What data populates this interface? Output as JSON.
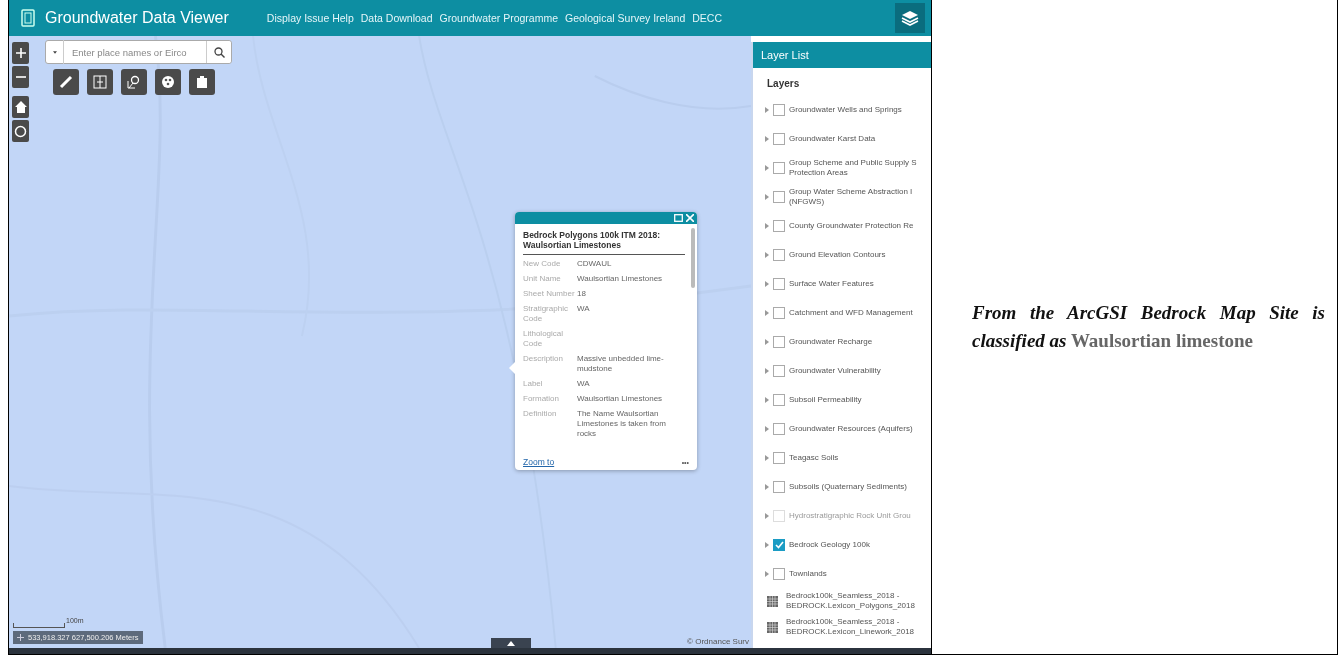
{
  "header": {
    "title": "Groundwater Data Viewer",
    "links": [
      "Display Issue Help",
      "Data Download",
      "Groundwater Programme",
      "Geological Survey Ireland",
      "DECC"
    ]
  },
  "search": {
    "placeholder": "Enter place names or Eirco"
  },
  "map": {
    "kind": "picture",
    "scale": "100m",
    "coordinates": "533,918.327 627,500.206 Meters",
    "attribution": "© Ordnance Surv"
  },
  "popup": {
    "title": "Bedrock Polygons 100k ITM 2018: Waulsortian Limestones",
    "fields": [
      {
        "label": "New Code",
        "value": "CDWAUL"
      },
      {
        "label": "Unit Name",
        "value": "Waulsortian Limestones"
      },
      {
        "label": "Sheet Number",
        "value": "18"
      },
      {
        "label": "Stratigraphic Code",
        "value": "WA"
      },
      {
        "label": "Lithological Code"
      },
      {
        "label": "Description",
        "value": "Massive unbedded lime-mudstone"
      },
      {
        "label": "Label",
        "value": "WA"
      },
      {
        "label": "Formation",
        "value": "Waulsortian Limestones"
      },
      {
        "label": "Definition",
        "value": "The Name Waulsortian Limestones is taken from rocks"
      }
    ],
    "link": "Zoom to",
    "more": "•••"
  },
  "layer_list": {
    "title": "Layer List",
    "heading": "Layers",
    "items": [
      {
        "kind": "layer",
        "label": "Groundwater Wells and Springs",
        "checked": false,
        "disabled": false
      },
      {
        "kind": "layer",
        "label": "Groundwater Karst Data",
        "checked": false,
        "disabled": false
      },
      {
        "kind": "layer",
        "label": "Group Scheme and Public Supply S Protection Areas",
        "checked": false,
        "disabled": false
      },
      {
        "kind": "layer",
        "label": "Group Water Scheme Abstraction I (NFGWS)",
        "checked": false,
        "disabled": false
      },
      {
        "kind": "layer",
        "label": "County Groundwater Protection Re",
        "checked": false,
        "disabled": false
      },
      {
        "kind": "layer",
        "label": "Ground Elevation Contours",
        "checked": false,
        "disabled": false
      },
      {
        "kind": "layer",
        "label": "Surface Water Features",
        "checked": false,
        "disabled": false
      },
      {
        "kind": "layer",
        "label": "Catchment and WFD Management",
        "checked": false,
        "disabled": false
      },
      {
        "kind": "layer",
        "label": "Groundwater Recharge",
        "checked": false,
        "disabled": false
      },
      {
        "kind": "layer",
        "label": "Groundwater Vulnerability",
        "checked": false,
        "disabled": false
      },
      {
        "kind": "layer",
        "label": "Subsoil Permeability",
        "checked": false,
        "disabled": false
      },
      {
        "kind": "layer",
        "label": "Groundwater Resources (Aquifers)",
        "checked": false,
        "disabled": false
      },
      {
        "kind": "layer",
        "label": "Teagasc Soils",
        "checked": false,
        "disabled": false
      },
      {
        "kind": "layer",
        "label": "Subsoils (Quaternary Sediments)",
        "checked": false,
        "disabled": false
      },
      {
        "kind": "layer",
        "label": "Hydrostratigraphic Rock Unit Grou",
        "checked": false,
        "disabled": true
      },
      {
        "kind": "layer",
        "label": "Bedrock Geology 100k",
        "checked": true,
        "disabled": false
      },
      {
        "kind": "layer",
        "label": "Townlands",
        "checked": false,
        "disabled": false
      },
      {
        "kind": "table",
        "label": "Bedrock100k_Seamless_2018 - BEDROCK.Lexicon_Polygons_2018"
      },
      {
        "kind": "table",
        "label": "Bedrock100k_Seamless_2018 - BEDROCK.Lexicon_Linework_2018"
      }
    ]
  },
  "caption": {
    "lead": "From the ArcGSI Bedrock Map Site is classified as",
    "term": "Waulsortian limestone"
  }
}
